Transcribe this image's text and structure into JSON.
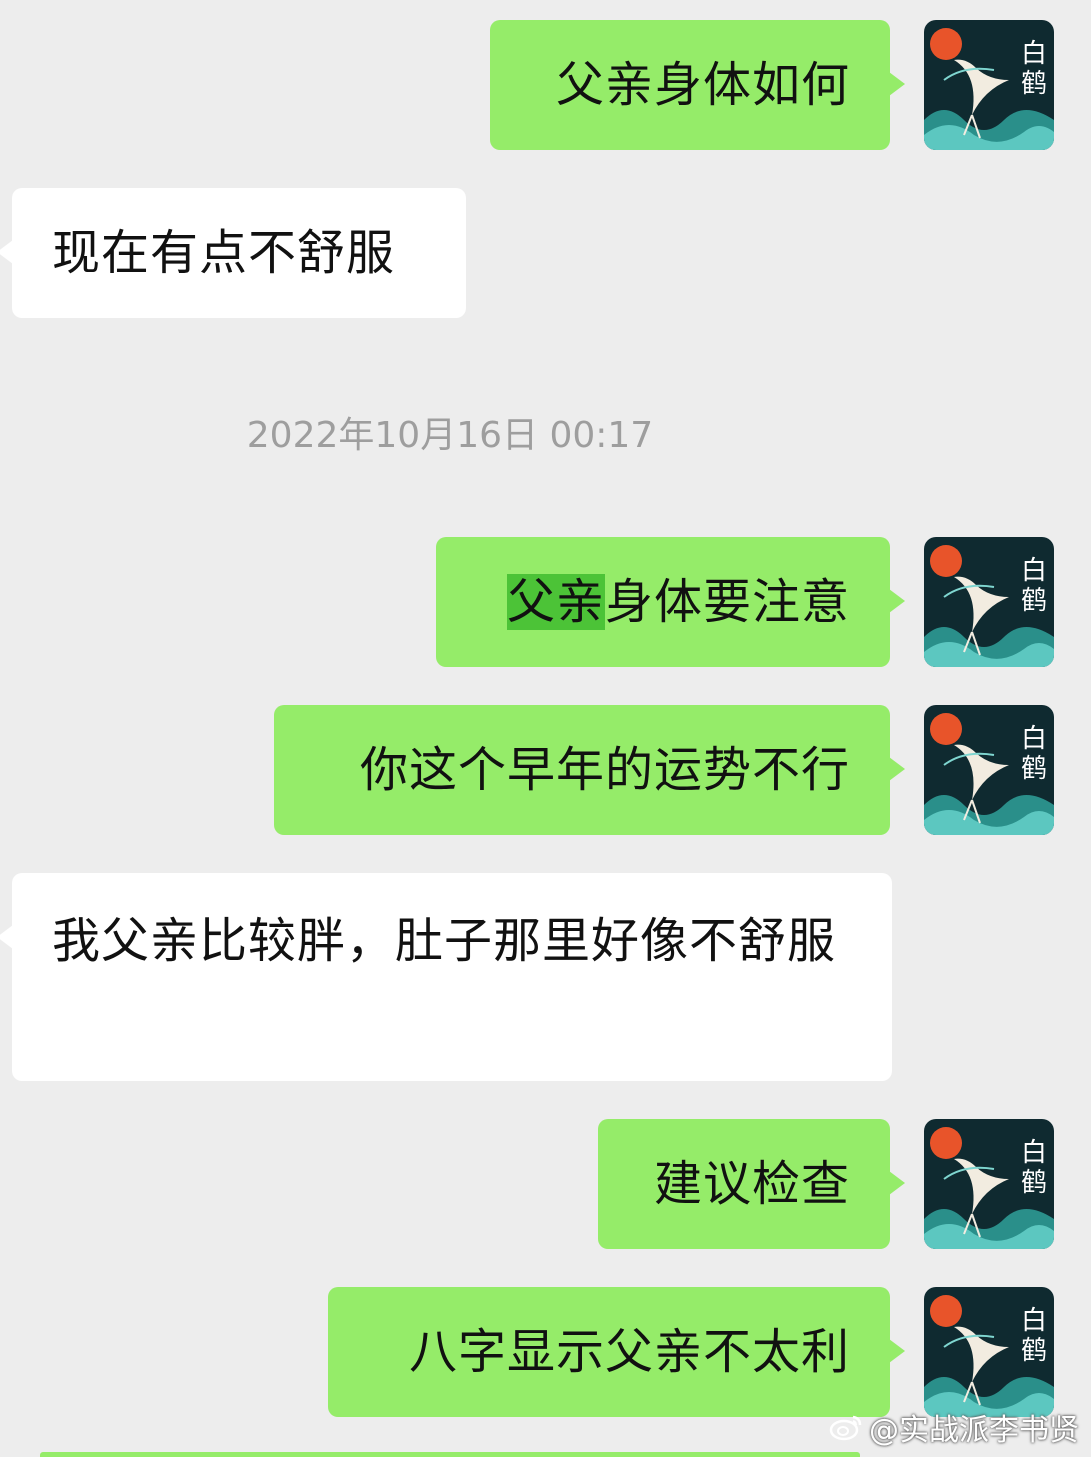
{
  "colors": {
    "background": "#ededed",
    "outgoing_bubble": "#95ec69",
    "incoming_bubble": "#ffffff",
    "highlight": "#4cc337",
    "timestamp_text": "#9e9e9e"
  },
  "avatar": {
    "icon": "white-crane-avatar-icon",
    "label_line1": "白",
    "label_line2": "鹤"
  },
  "timestamp": "2022年10月16日 00:17",
  "messages": [
    {
      "direction": "outgoing",
      "text": "父亲身体如何"
    },
    {
      "direction": "incoming",
      "text": "现在有点不舒服"
    },
    {
      "direction": "outgoing",
      "text_highlighted": "父亲",
      "text_rest": "身体要注意"
    },
    {
      "direction": "outgoing",
      "text": "你这个早年的运势不行"
    },
    {
      "direction": "incoming",
      "text": "我父亲比较胖，肚子那里好像不舒服"
    },
    {
      "direction": "outgoing",
      "text": "建议检查"
    },
    {
      "direction": "outgoing",
      "text": "八字显示父亲不太利"
    }
  ],
  "watermark": {
    "icon": "weibo-icon",
    "text": "@实战派李书贤"
  }
}
